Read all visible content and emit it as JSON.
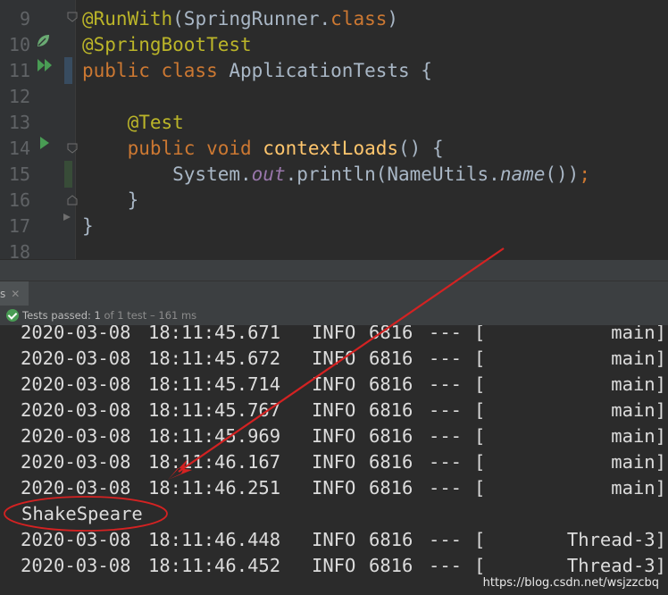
{
  "editor": {
    "lines": [
      {
        "num": "9",
        "tokens": [
          {
            "t": "@RunWith",
            "c": "ann"
          },
          {
            "t": "(SpringRunner.",
            "c": ""
          },
          {
            "t": "class",
            "c": "kw"
          },
          {
            "t": ")",
            "c": ""
          }
        ]
      },
      {
        "num": "10",
        "tokens": [
          {
            "t": "@SpringBootTest",
            "c": "ann"
          }
        ]
      },
      {
        "num": "11",
        "tokens": [
          {
            "t": "public class ",
            "c": "kw"
          },
          {
            "t": "ApplicationTests {",
            "c": ""
          }
        ]
      },
      {
        "num": "12",
        "tokens": []
      },
      {
        "num": "13",
        "tokens": [
          {
            "t": "    ",
            "c": ""
          },
          {
            "t": "@Test",
            "c": "ann"
          }
        ]
      },
      {
        "num": "14",
        "tokens": [
          {
            "t": "    ",
            "c": ""
          },
          {
            "t": "public void ",
            "c": "kw"
          },
          {
            "t": "contextLoads",
            "c": "fn"
          },
          {
            "t": "() {",
            "c": ""
          }
        ]
      },
      {
        "num": "15",
        "tokens": [
          {
            "t": "        System.",
            "c": ""
          },
          {
            "t": "out",
            "c": "fld"
          },
          {
            "t": ".println(NameUtils.",
            "c": ""
          },
          {
            "t": "name",
            "c": "itl"
          },
          {
            "t": "())",
            "c": ""
          },
          {
            "t": ";",
            "c": "kw"
          }
        ]
      },
      {
        "num": "16",
        "tokens": [
          {
            "t": "    }",
            "c": ""
          }
        ]
      },
      {
        "num": "17",
        "tokens": [
          {
            "t": "}",
            "c": ""
          }
        ]
      },
      {
        "num": "18",
        "tokens": []
      }
    ]
  },
  "tab": {
    "label": "s",
    "close": "✕"
  },
  "status": {
    "label": "Tests passed:",
    "count": "1",
    "of_text": "of 1 test",
    "duration": "– 161 ms"
  },
  "console": {
    "rows_top": [
      {
        "date": "2020-03-08",
        "time": "18:11:45.671",
        "level": "INFO",
        "pid": "6816",
        "dash": "---",
        "br": "[",
        "thread": "main]"
      },
      {
        "date": "2020-03-08",
        "time": "18:11:45.672",
        "level": "INFO",
        "pid": "6816",
        "dash": "---",
        "br": "[",
        "thread": "main]"
      },
      {
        "date": "2020-03-08",
        "time": "18:11:45.714",
        "level": "INFO",
        "pid": "6816",
        "dash": "---",
        "br": "[",
        "thread": "main]"
      },
      {
        "date": "2020-03-08",
        "time": "18:11:45.767",
        "level": "INFO",
        "pid": "6816",
        "dash": "---",
        "br": "[",
        "thread": "main]"
      },
      {
        "date": "2020-03-08",
        "time": "18:11:45.969",
        "level": "INFO",
        "pid": "6816",
        "dash": "---",
        "br": "[",
        "thread": "main]"
      },
      {
        "date": "2020-03-08",
        "time": "18:11:46.167",
        "level": "INFO",
        "pid": "6816",
        "dash": "---",
        "br": "[",
        "thread": "main]"
      },
      {
        "date": "2020-03-08",
        "time": "18:11:46.251",
        "level": "INFO",
        "pid": "6816",
        "dash": "---",
        "br": "[",
        "thread": "main]"
      }
    ],
    "output": "ShakeSpeare",
    "rows_bottom": [
      {
        "date": "2020-03-08",
        "time": "18:11:46.448",
        "level": "INFO",
        "pid": "6816",
        "dash": "---",
        "br": "[",
        "thread": "Thread-3]"
      },
      {
        "date": "2020-03-08",
        "time": "18:11:46.452",
        "level": "INFO",
        "pid": "6816",
        "dash": "---",
        "br": "[",
        "thread": "Thread-3]"
      }
    ]
  },
  "watermark": "https://blog.csdn.net/wsjzzcbq",
  "colors": {
    "annotation": "#ff2020",
    "pass": "#499c54"
  }
}
